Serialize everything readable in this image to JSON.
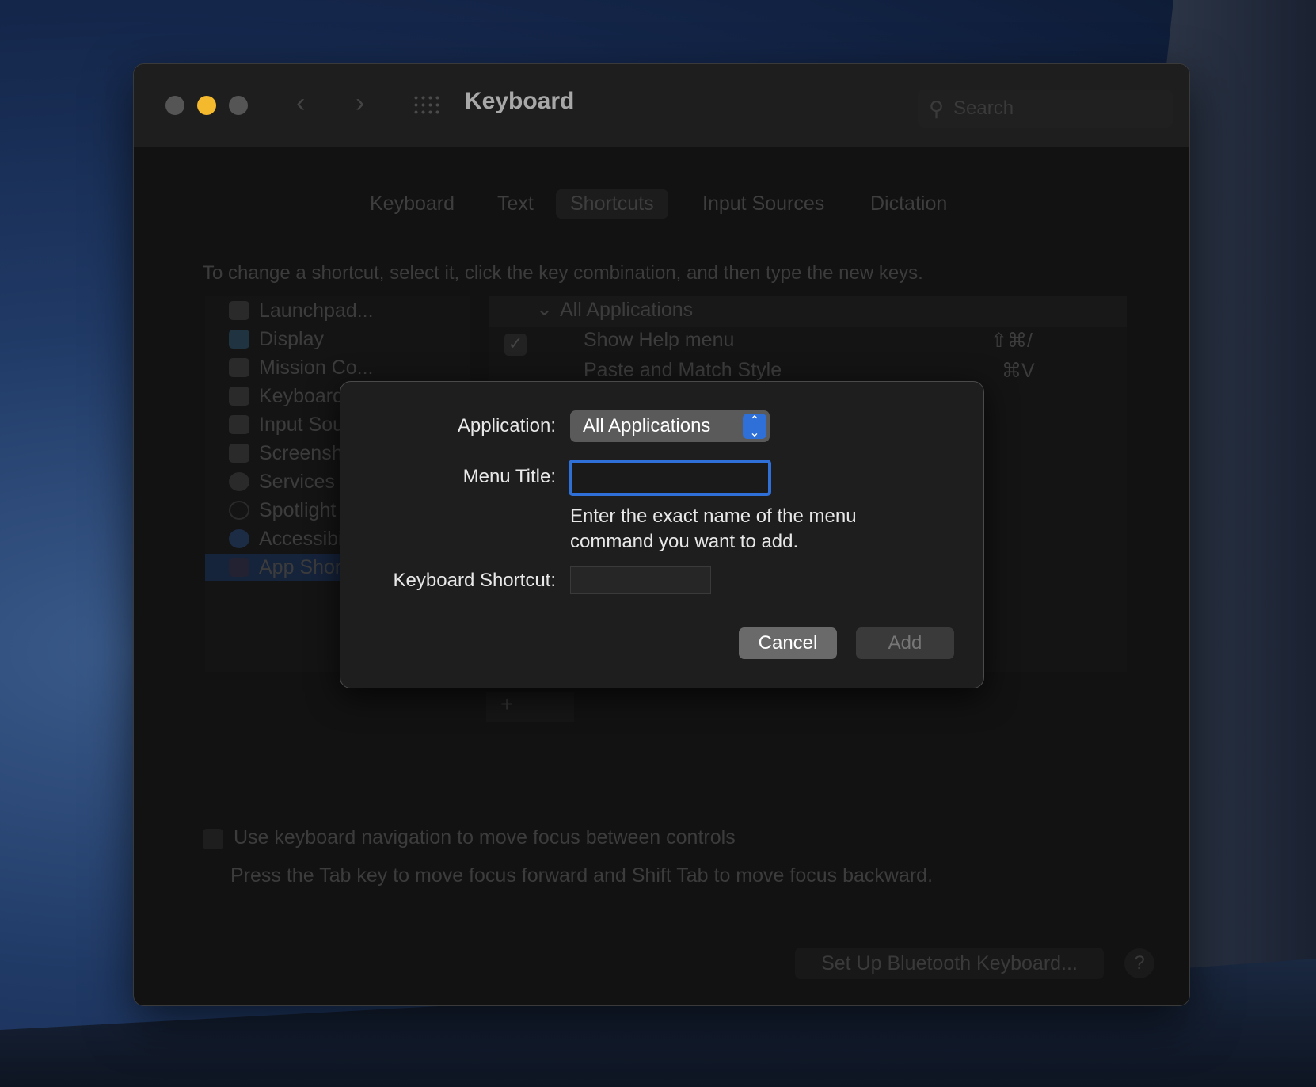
{
  "window": {
    "title": "Keyboard",
    "search_placeholder": "Search"
  },
  "tabs": [
    {
      "label": "Keyboard"
    },
    {
      "label": "Text"
    },
    {
      "label": "Shortcuts",
      "selected": true
    },
    {
      "label": "Input Sources"
    },
    {
      "label": "Dictation"
    }
  ],
  "instruction": "To change a shortcut, select it, click the key combination, and then type the new keys.",
  "categories": [
    {
      "label": "Launchpad..."
    },
    {
      "label": "Display"
    },
    {
      "label": "Mission Co..."
    },
    {
      "label": "Keyboard"
    },
    {
      "label": "Input Sources"
    },
    {
      "label": "Screenshots"
    },
    {
      "label": "Services"
    },
    {
      "label": "Spotlight"
    },
    {
      "label": "Accessibility"
    },
    {
      "label": "App Shortcuts",
      "selected": true
    }
  ],
  "shortcuts": {
    "group": "All Applications",
    "rows": [
      {
        "name": "Show Help menu",
        "keys": "⇧⌘/",
        "checked": true
      },
      {
        "name": "Paste and Match Style",
        "keys": "⌘V"
      }
    ]
  },
  "plus_label": "+",
  "keyboard_nav": {
    "label": "Use keyboard navigation to move focus between controls",
    "hint": "Press the Tab key to move focus forward and Shift Tab to move focus backward.",
    "checked": false
  },
  "bluetooth_button": "Set Up Bluetooth Keyboard...",
  "help_label": "?",
  "dialog": {
    "application_label": "Application:",
    "application_value": "All Applications",
    "menu_title_label": "Menu Title:",
    "menu_title_value": "",
    "help_line1": "Enter the exact name of the menu",
    "help_line2": "command you want to add.",
    "shortcut_label": "Keyboard Shortcut:",
    "cancel": "Cancel",
    "add": "Add"
  },
  "colors": {
    "accent": "#2f6fd8",
    "close": "#5a5a5a",
    "minimize": "#f5b92e"
  }
}
